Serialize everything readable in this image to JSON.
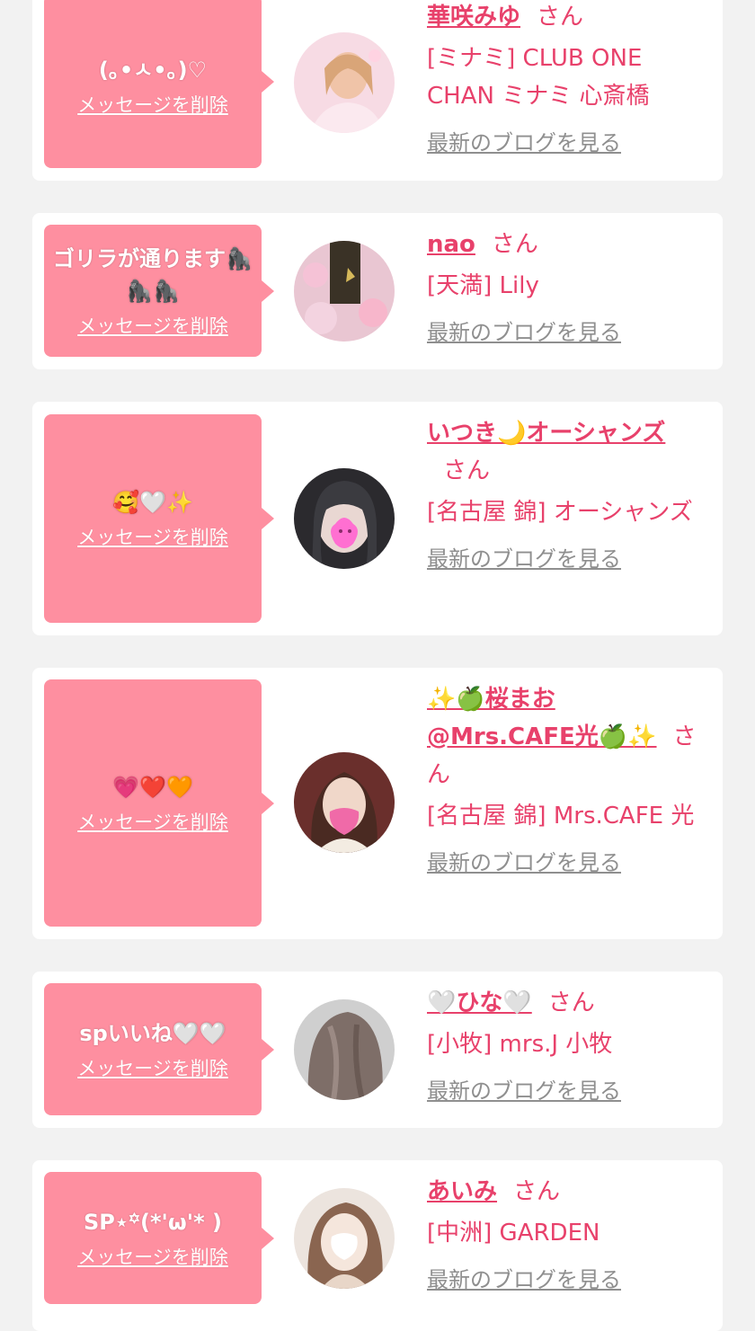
{
  "delete_label": "メッセージを削除",
  "blog_label": "最新のブログを見る",
  "honorific": "さん",
  "colors": {
    "background": "#f2f2f2",
    "card": "#ffffff",
    "bubble": "#fe8fa0",
    "name": "#e8416b",
    "blog_link": "#8f8f8f"
  },
  "items": [
    {
      "message": "(｡•ㅅ•｡)♡",
      "name": "華咲みゆ",
      "shop": "[ミナミ] CLUB ONE CHAN ミナミ 心斎橋",
      "avatar_icon": "avatar-photo"
    },
    {
      "message": "ゴリラが通ります🦍🦍🦍",
      "name": "nao",
      "shop": "[天満] Lily",
      "avatar_icon": "avatar-photo"
    },
    {
      "message": "🥰🤍✨",
      "name": "いつき🌙オーシャンズ",
      "shop": "[名古屋 錦] オーシャンズ",
      "avatar_icon": "avatar-photo"
    },
    {
      "message": "💗❤️🧡",
      "name": "✨🍏桜まお@Mrs.CAFE光🍏✨",
      "shop": "[名古屋 錦] Mrs.CAFE 光",
      "avatar_icon": "avatar-photo"
    },
    {
      "message": "spいいね🤍🤍",
      "name": "🤍ひな🤍",
      "shop": "[小牧] mrs.J 小牧",
      "avatar_icon": "avatar-photo"
    },
    {
      "message": "SP⋆꙳(*'ω'* )",
      "name": "あいみ",
      "shop": "[中洲] GARDEN",
      "avatar_icon": "avatar-photo"
    }
  ]
}
